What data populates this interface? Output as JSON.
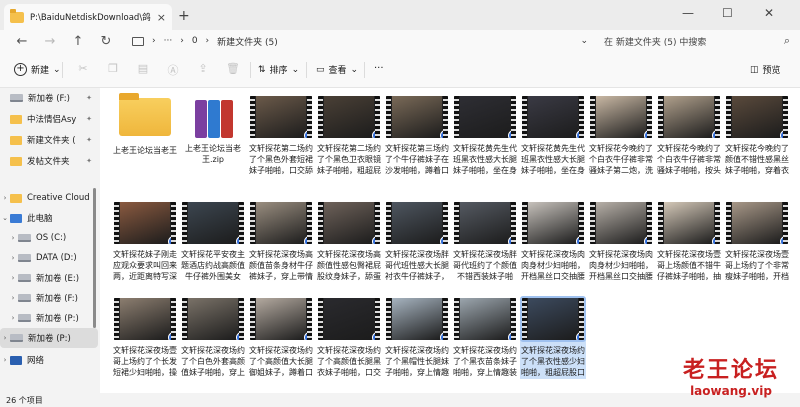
{
  "window": {
    "tab_title": "P:\\BaiduNetdiskDownload\\鸽",
    "tab_close": "×",
    "new_tab": "+",
    "minimize": "—",
    "maximize": "☐",
    "close": "✕"
  },
  "nav": {
    "back": "←",
    "forward": "→",
    "up": "↑",
    "refresh": "↻",
    "breadcrumb_more": "···",
    "breadcrumb_sep1": "›",
    "breadcrumb_root": "0",
    "breadcrumb_sep2": "›",
    "breadcrumb_current": "新建文件夹 (5)",
    "breadcrumb_sep3": "›",
    "breadcrumb_dropdown": "⌄",
    "search_placeholder": "在 新建文件夹 (5) 中搜索",
    "search_icon": "⌕"
  },
  "toolbar": {
    "new_label": "新建",
    "new_caret": "⌄",
    "sort_label": "排序",
    "sort_caret": "⌄",
    "view_label": "查看",
    "view_caret": "⌄",
    "more": "···",
    "preview_label": "预览",
    "icons": [
      "cut-icon",
      "copy-icon",
      "paste-icon",
      "rename-icon",
      "share-icon",
      "delete-icon"
    ]
  },
  "sidebar": {
    "items": [
      {
        "label": "新加卷 (F:)",
        "type": "drive",
        "pinned": true
      },
      {
        "label": "中法情侣Asy",
        "type": "folder",
        "pinned": true
      },
      {
        "label": "新建文件夹 (",
        "type": "folder",
        "pinned": true
      },
      {
        "label": "发帖文件夹",
        "type": "folder",
        "pinned": true
      },
      {
        "label": "Creative Cloud",
        "type": "cloud"
      },
      {
        "label": "此电脑",
        "type": "pc"
      },
      {
        "label": "OS (C:)",
        "type": "drive"
      },
      {
        "label": "DATA (D:)",
        "type": "drive"
      },
      {
        "label": "新加卷 (E:)",
        "type": "drive"
      },
      {
        "label": "新加卷 (F:)",
        "type": "drive"
      },
      {
        "label": "新加卷 (P:)",
        "type": "drive"
      },
      {
        "label": "新加卷 (P:)",
        "type": "drive",
        "selected": true
      },
      {
        "label": "网络",
        "type": "network"
      }
    ],
    "pin_glyph": "📌",
    "chevron_right": "›",
    "chevron_down": "⌄"
  },
  "files": [
    {
      "name": "上老王论坛当老王",
      "kind": "folder"
    },
    {
      "name": "上老王论坛当老王.zip",
      "kind": "zip"
    },
    {
      "name": "文轩探花第二场约了个黑色外套短裙妹子啪啪，口交舔弄后入...",
      "kind": "video",
      "tone": "#6b5a4a"
    },
    {
      "name": "文轩探花第二场约了个黑色卫衣眼镜妹子啪啪，粗超屁股蓝牙...",
      "kind": "video",
      "tone": "#4a4036"
    },
    {
      "name": "文轩探花第三场约了个牛仔裤妹子在沙发啪啪，蹲着口交上位...",
      "kind": "video",
      "tone": "#7a6a58"
    },
    {
      "name": "文轩探花黄先生代班黑衣性感大长腿妹子啪啪，坐在身上摸奶舔...",
      "kind": "video",
      "tone": "#2e2e34"
    },
    {
      "name": "文轩探花黄先生代班黑衣性感大长腿妹子啪啪，坐在身上摸奶舔...",
      "kind": "video",
      "tone": "#3a3a44"
    },
    {
      "name": "文轩探花今晚约了个白衣牛仔裤非常骚妹子第二炮，洗完澡穿...",
      "kind": "video",
      "tone": "#c9b8a4"
    },
    {
      "name": "文轩探花今晚约了个白衣牛仔裤非常骚妹子啪啪，按头口交...",
      "kind": "video",
      "tone": "#b0a08c"
    },
    {
      "name": "文轩探花今晚约了颜值不错性感黑丝妹子啪啪，穿着衣服摸奶...",
      "kind": "video",
      "tone": "#5a4a3c"
    },
    {
      "name": "文轩探花妹子刚走应观众要求叫回来两，近距离特写深喉口交...",
      "kind": "video",
      "tone": "#8a5a40"
    },
    {
      "name": "文轩探花平安夜主题酒店约战高颜值牛仔裤外围美女 小姐够骚...",
      "kind": "video",
      "tone": "#3c4650"
    },
    {
      "name": "文轩探花深夜场高颜值苗条身材牛仔裤妹子，穿上带情趣装...",
      "kind": "video",
      "tone": "#9a8e80"
    },
    {
      "name": "文轩探花深夜场高颜值性感包臀裙屁股纹身妹子，舔蛋口交...",
      "kind": "video",
      "tone": "#6e625a"
    },
    {
      "name": "文轩探花深夜场胖哥代班性感大长腿衬衣牛仔裤妹子，穿上黑...",
      "kind": "video",
      "tone": "#4e5660"
    },
    {
      "name": "文轩探花深夜场胖哥代班约了个颜值不错西装妹子啪啪，换上...",
      "kind": "video",
      "tone": "#555a62"
    },
    {
      "name": "文轩探花深夜场肉肉身材少妇啪啪，开档黑丝口交抽腰大力猛...",
      "kind": "video",
      "tone": "#c7c2bc"
    },
    {
      "name": "文轩探花深夜场肉肉身材少妇啪啪，开档黑丝口交抽腰大力猛...",
      "kind": "video",
      "tone": "#b7b0a8"
    },
    {
      "name": "文轩探花深夜场壹哥上场颜值不错牛仔裤妹子啪啪，抽腰摩擦...",
      "kind": "video",
      "tone": "#d4c8b8"
    },
    {
      "name": "文轩探花深夜场壹哥上场约了个非常瘦妹子啪啪，开档黑丝口...",
      "kind": "video",
      "tone": "#a89888"
    },
    {
      "name": "文轩探花深夜场壹哥上场约了个长发短裙少妇啪啪，操起裙子...",
      "kind": "video",
      "tone": "#8c7e70"
    },
    {
      "name": "文轩探花深夜场约了个白色外套高颜值妹子啪啪，穿上睡衣...",
      "kind": "video",
      "tone": "#7a7268"
    },
    {
      "name": "文轩探花深夜场约了个高颜值大长腿御姐妹子，蹲着口交舔弄...",
      "kind": "video",
      "tone": "#b4aaa0"
    },
    {
      "name": "文轩探花深夜场约了个高颜值长腿黑衣妹子啪啪，口交互舔...",
      "kind": "video",
      "tone": "#2a2a2e"
    },
    {
      "name": "文轩探花深夜场约了个黑帽性长腿妹子啪啪，穿上情趣吊带...",
      "kind": "video",
      "tone": "#a7b4c0"
    },
    {
      "name": "文轩探花深夜场约了个黑衣苗条妹子啪啪，穿上情趣装近视口...",
      "kind": "video",
      "tone": "#9ca6ae"
    },
    {
      "name": "文轩探花深夜场约了个黑衣性感少妇啪啪，粗超屁股口交舔边...",
      "kind": "video",
      "tone": "#3c4a5e",
      "selected": true
    }
  ],
  "status": {
    "count": "26 个项目"
  },
  "watermark": {
    "line1": "老王论坛",
    "line2": "laowang.vip"
  },
  "colors": {
    "accent": "#2d6ad9",
    "folder": "#f5c04c",
    "selection": "#cce0f8",
    "watermark": "#c82020"
  }
}
